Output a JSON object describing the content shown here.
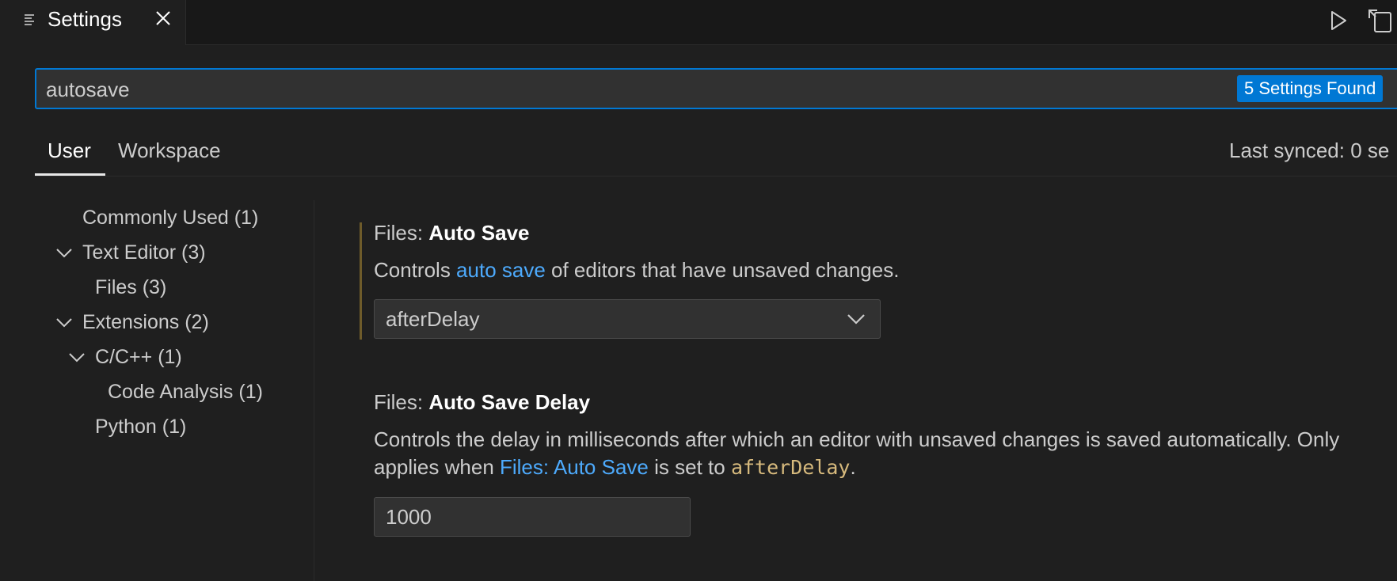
{
  "tab": {
    "title": "Settings",
    "icon": "settings-list-icon",
    "close_icon": "close-icon"
  },
  "toolbar": {
    "run_icon": "play-icon",
    "split_icon": "open-settings-json-icon"
  },
  "search": {
    "value": "autosave",
    "results_badge": "5 Settings Found"
  },
  "scope_tabs": [
    {
      "label": "User",
      "active": true
    },
    {
      "label": "Workspace",
      "active": false
    }
  ],
  "last_synced": "Last synced: 0 se",
  "tree": [
    {
      "label": "Commonly Used (1)",
      "expanded": null
    },
    {
      "label": "Text Editor (3)",
      "expanded": true
    },
    {
      "label": "Files (3)",
      "expanded": null
    },
    {
      "label": "Extensions (2)",
      "expanded": true
    },
    {
      "label": "C/C++ (1)",
      "expanded": true
    },
    {
      "label": "Code Analysis (1)",
      "expanded": null
    },
    {
      "label": "Python (1)",
      "expanded": null
    }
  ],
  "settings": [
    {
      "category": "Files: ",
      "name": "Auto Save",
      "desc_before": "Controls ",
      "desc_link": "auto save",
      "desc_after": " of editors that have unsaved changes.",
      "value": "afterDelay"
    },
    {
      "category": "Files: ",
      "name": "Auto Save Delay",
      "desc_line1": "Controls the delay in milliseconds after which an editor with unsaved changes is saved automatically. Only",
      "desc_line2_before": "applies when ",
      "desc_line2_link": "Files: Auto Save",
      "desc_line2_mid": " is set to ",
      "desc_line2_code": "afterDelay",
      "desc_line2_after": ".",
      "value": "1000"
    }
  ],
  "colors": {
    "accent": "#0078d4",
    "link": "#4daafc",
    "code": "#d7ba7d",
    "modified_marker": "#6e5b2a",
    "background": "#1f1f1f"
  }
}
